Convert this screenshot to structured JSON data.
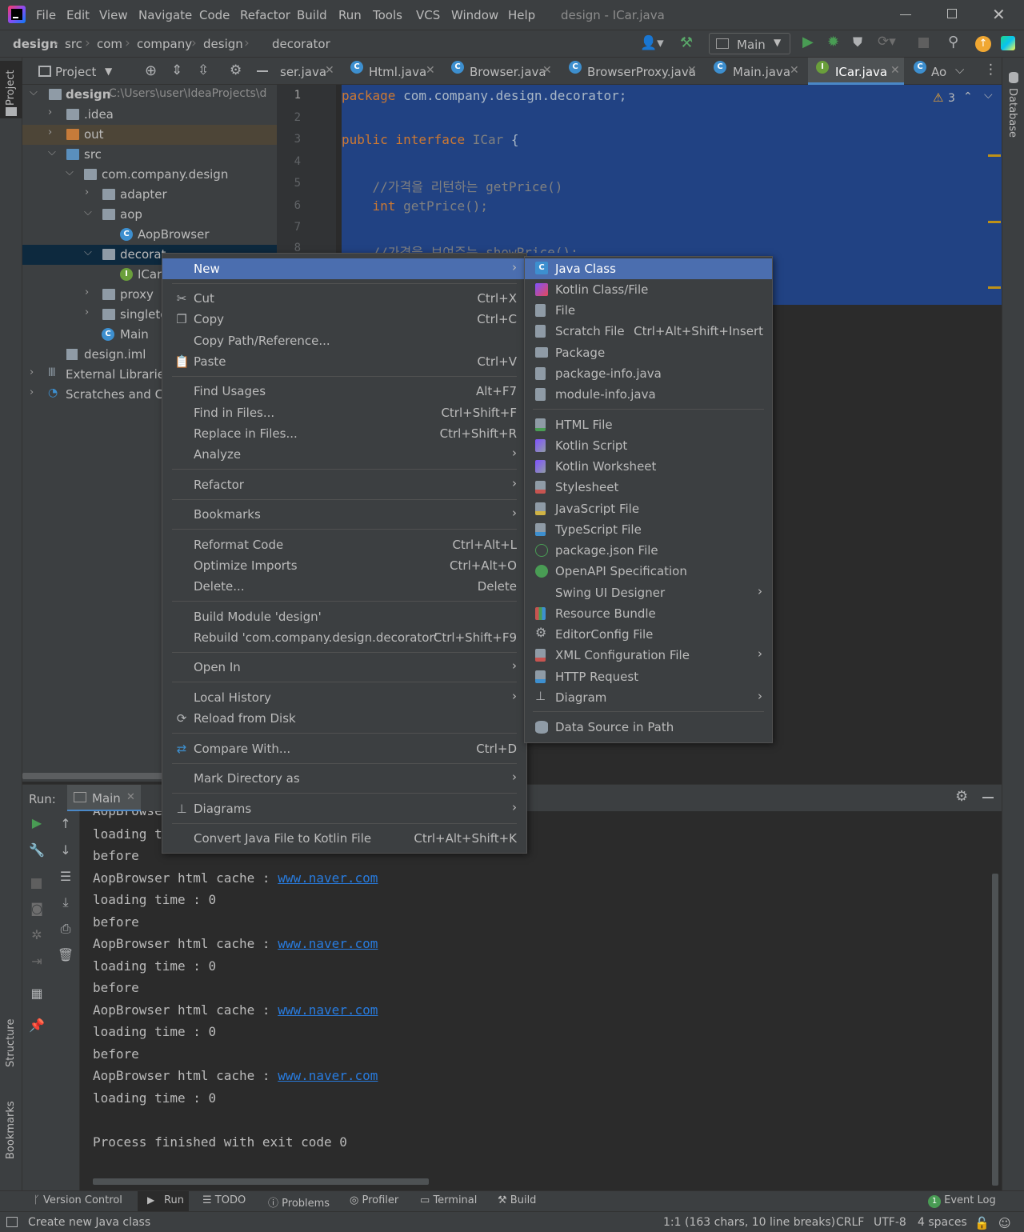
{
  "window": {
    "title": "design - ICar.java",
    "menu": [
      "File",
      "Edit",
      "View",
      "Navigate",
      "Code",
      "Refactor",
      "Build",
      "Run",
      "Tools",
      "VCS",
      "Window",
      "Help"
    ]
  },
  "breadcrumb": [
    "design",
    "src",
    "com",
    "company",
    "design",
    "decorator"
  ],
  "run_config": "Main",
  "side_labels": {
    "project": "Project",
    "structure": "Structure",
    "bookmarks": "Bookmarks",
    "database": "Database"
  },
  "project": {
    "header": "Project",
    "tree": [
      {
        "label": "design",
        "extra": "C:\\Users\\user\\IdeaProjects\\d"
      },
      {
        "label": ".idea"
      },
      {
        "label": "out"
      },
      {
        "label": "src"
      },
      {
        "label": "com.company.design"
      },
      {
        "label": "adapter"
      },
      {
        "label": "aop"
      },
      {
        "label": "AopBrowser"
      },
      {
        "label": "decorat"
      },
      {
        "label": "ICar"
      },
      {
        "label": "proxy"
      },
      {
        "label": "singleto"
      },
      {
        "label": "Main"
      },
      {
        "label": "design.iml"
      },
      {
        "label": "External Libraries"
      },
      {
        "label": "Scratches and Co"
      }
    ]
  },
  "tabs": [
    "ser.java",
    "Html.java",
    "Browser.java",
    "BrowserProxy.java",
    "Main.java",
    "ICar.java",
    "Ao"
  ],
  "editor": {
    "warnings": "3",
    "lines": [
      "1",
      "2",
      "3",
      "4",
      "5",
      "6",
      "7",
      "8"
    ],
    "code": {
      "l1_kw": "package",
      "l1_rest": " com.company.design.decorator;",
      "l3_kw": "public interface",
      "l3_name": " ICar",
      "l3_rest": " {",
      "l5": "    //가격을 리턴하는 getPrice()",
      "l6_kw": "    int",
      "l6_rest": " getPrice();",
      "l8": "    //가격을 보여주는 showPrice();"
    }
  },
  "context_menu": {
    "items": [
      {
        "label": "New",
        "shortcut": "",
        "submenu": true
      },
      {
        "label": "Cut",
        "shortcut": "Ctrl+X"
      },
      {
        "label": "Copy",
        "shortcut": "Ctrl+C"
      },
      {
        "label": "Copy Path/Reference...",
        "shortcut": ""
      },
      {
        "label": "Paste",
        "shortcut": "Ctrl+V"
      },
      {
        "label": "Find Usages",
        "shortcut": "Alt+F7"
      },
      {
        "label": "Find in Files...",
        "shortcut": "Ctrl+Shift+F"
      },
      {
        "label": "Replace in Files...",
        "shortcut": "Ctrl+Shift+R"
      },
      {
        "label": "Analyze",
        "shortcut": "",
        "submenu": true
      },
      {
        "label": "Refactor",
        "shortcut": "",
        "submenu": true
      },
      {
        "label": "Bookmarks",
        "shortcut": "",
        "submenu": true
      },
      {
        "label": "Reformat Code",
        "shortcut": "Ctrl+Alt+L"
      },
      {
        "label": "Optimize Imports",
        "shortcut": "Ctrl+Alt+O"
      },
      {
        "label": "Delete...",
        "shortcut": "Delete"
      },
      {
        "label": "Build Module 'design'",
        "shortcut": ""
      },
      {
        "label": "Rebuild 'com.company.design.decorator'",
        "shortcut": "Ctrl+Shift+F9"
      },
      {
        "label": "Open In",
        "shortcut": "",
        "submenu": true
      },
      {
        "label": "Local History",
        "shortcut": "",
        "submenu": true
      },
      {
        "label": "Reload from Disk",
        "shortcut": ""
      },
      {
        "label": "Compare With...",
        "shortcut": "Ctrl+D"
      },
      {
        "label": "Mark Directory as",
        "shortcut": "",
        "submenu": true
      },
      {
        "label": "Diagrams",
        "shortcut": "",
        "submenu": true
      },
      {
        "label": "Convert Java File to Kotlin File",
        "shortcut": "Ctrl+Alt+Shift+K"
      }
    ]
  },
  "new_submenu": {
    "items": [
      {
        "label": "Java Class",
        "shortcut": ""
      },
      {
        "label": "Kotlin Class/File",
        "shortcut": ""
      },
      {
        "label": "File",
        "shortcut": ""
      },
      {
        "label": "Scratch File",
        "shortcut": "Ctrl+Alt+Shift+Insert"
      },
      {
        "label": "Package",
        "shortcut": ""
      },
      {
        "label": "package-info.java",
        "shortcut": ""
      },
      {
        "label": "module-info.java",
        "shortcut": ""
      },
      {
        "label": "HTML File",
        "shortcut": ""
      },
      {
        "label": "Kotlin Script",
        "shortcut": ""
      },
      {
        "label": "Kotlin Worksheet",
        "shortcut": ""
      },
      {
        "label": "Stylesheet",
        "shortcut": ""
      },
      {
        "label": "JavaScript File",
        "shortcut": ""
      },
      {
        "label": "TypeScript File",
        "shortcut": ""
      },
      {
        "label": "package.json File",
        "shortcut": ""
      },
      {
        "label": "OpenAPI Specification",
        "shortcut": ""
      },
      {
        "label": "Swing UI Designer",
        "shortcut": "",
        "submenu": true
      },
      {
        "label": "Resource Bundle",
        "shortcut": ""
      },
      {
        "label": "EditorConfig File",
        "shortcut": ""
      },
      {
        "label": "XML Configuration File",
        "shortcut": "",
        "submenu": true
      },
      {
        "label": "HTTP Request",
        "shortcut": ""
      },
      {
        "label": "Diagram",
        "shortcut": "",
        "submenu": true
      },
      {
        "label": "Data Source in Path",
        "shortcut": ""
      }
    ]
  },
  "run_panel": {
    "label": "Run:",
    "tab": "Main",
    "console": [
      "AopBrowse",
      "loading t",
      "before",
      "AopBrowser html cache : |www.naver.com",
      "loading time : 0",
      "before",
      "AopBrowser html cache : |www.naver.com",
      "loading time : 0",
      "before",
      "AopBrowser html cache : |www.naver.com",
      "loading time : 0",
      "before",
      "AopBrowser html cache : |www.naver.com",
      "loading time : 0",
      "",
      "Process finished with exit code 0"
    ]
  },
  "toolwindows": [
    "Version Control",
    "Run",
    "TODO",
    "Problems",
    "Profiler",
    "Terminal",
    "Build",
    "Event Log"
  ],
  "event_log_count": "1",
  "status": {
    "message": "Create new Java class",
    "position": "1:1 (163 chars, 10 line breaks)",
    "line_sep": "CRLF",
    "encoding": "UTF-8",
    "indent": "4 spaces"
  },
  "colors": {
    "selection": "#4b6eaf",
    "editor_selection": "#214283",
    "keyword": "#cc7832",
    "link": "#287bde"
  }
}
